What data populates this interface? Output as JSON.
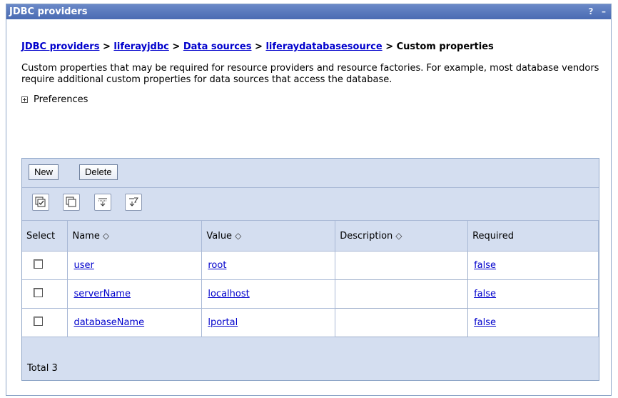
{
  "window": {
    "title": "JDBC providers",
    "help_icon": "?",
    "minimize_icon": "–"
  },
  "breadcrumb": {
    "items": [
      "JDBC providers",
      "liferayjdbc",
      "Data sources",
      "liferaydatabasesource"
    ],
    "separator": ">",
    "current": "Custom properties"
  },
  "description": "Custom properties that may be required for resource providers and resource factories. For example, most database vendors require additional custom properties for data sources that access the database.",
  "preferences": {
    "label": "Preferences",
    "icon": "expand-plus-icon"
  },
  "toolbar": {
    "new_label": "New",
    "delete_label": "Delete"
  },
  "tools": [
    "select-all-icon",
    "deselect-all-icon",
    "show-filter-icon",
    "clear-filter-icon"
  ],
  "table": {
    "columns": {
      "select": "Select",
      "name": "Name",
      "value": "Value",
      "description": "Description",
      "required": "Required",
      "sort_icon": "◇"
    },
    "rows": [
      {
        "name": "user",
        "value": "root",
        "description": "",
        "required": "false",
        "selected": false
      },
      {
        "name": "serverName",
        "value": "localhost",
        "description": "",
        "required": "false",
        "selected": false
      },
      {
        "name": "databaseName",
        "value": "lportal",
        "description": "",
        "required": "false",
        "selected": false
      }
    ],
    "total": "Total 3"
  },
  "colors": {
    "title_bar": "#4a6bb3",
    "panel": "#d4def0",
    "link": "#0000cc",
    "border": "#8fa6c8"
  }
}
